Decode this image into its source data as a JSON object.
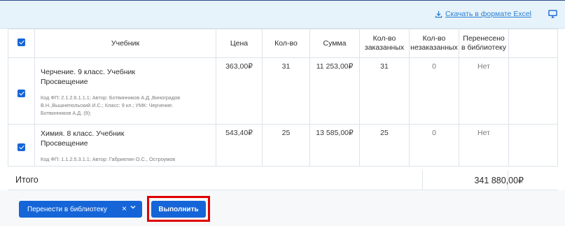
{
  "toolbar": {
    "download_label": "Скачать в формате Excel",
    "download_icon": "download-icon",
    "screen_icon": "monitor-icon",
    "accent_color": "#2a7fd4"
  },
  "table": {
    "headers": {
      "select_all_checked": true,
      "textbook": "Учебник",
      "price": "Цена",
      "qty": "Кол-во",
      "sum": "Сумма",
      "ordered": [
        "Кол-во",
        "заказанных"
      ],
      "not_ordered": [
        "Кол-во",
        "незаказанных"
      ],
      "moved": [
        "Перенесено",
        "в библиотеку"
      ]
    },
    "rows": [
      {
        "checked": true,
        "title": [
          "Черчение. 9 класс. Учебник",
          "Просвещение"
        ],
        "meta": [
          "Код ФП: 2.1.2.6.1.1.1; Автор: Ботвинников А.Д.,Виноградов",
          "В.Н.,Вышнепольский И.С.; Класс: 9 кл.; УМК: Черчение.",
          "Ботвинников А.Д. (9);"
        ],
        "price": "363,00₽",
        "qty": "31",
        "sum": "11 253,00₽",
        "ordered": "31",
        "not_ordered": "0",
        "moved": "Нет"
      },
      {
        "checked": true,
        "title": [
          "Химия. 8 класс. Учебник",
          "Просвещение"
        ],
        "meta": [
          "Код ФП: 1.1.2.5.3.1.1; Автор: Габриелян О.С., Остроумов"
        ],
        "price": "543,40₽",
        "qty": "25",
        "sum": "13 585,00₽",
        "ordered": "25",
        "not_ordered": "0",
        "moved": "Нет"
      }
    ]
  },
  "totals": {
    "label": "Итого",
    "sum": "341 880,00₽"
  },
  "footer": {
    "action_select_label": "Перенести в библиотеку",
    "clear_symbol": "×",
    "run_label": "Выполнить",
    "button_color": "#1565d8",
    "highlight_color": "#e00000"
  }
}
